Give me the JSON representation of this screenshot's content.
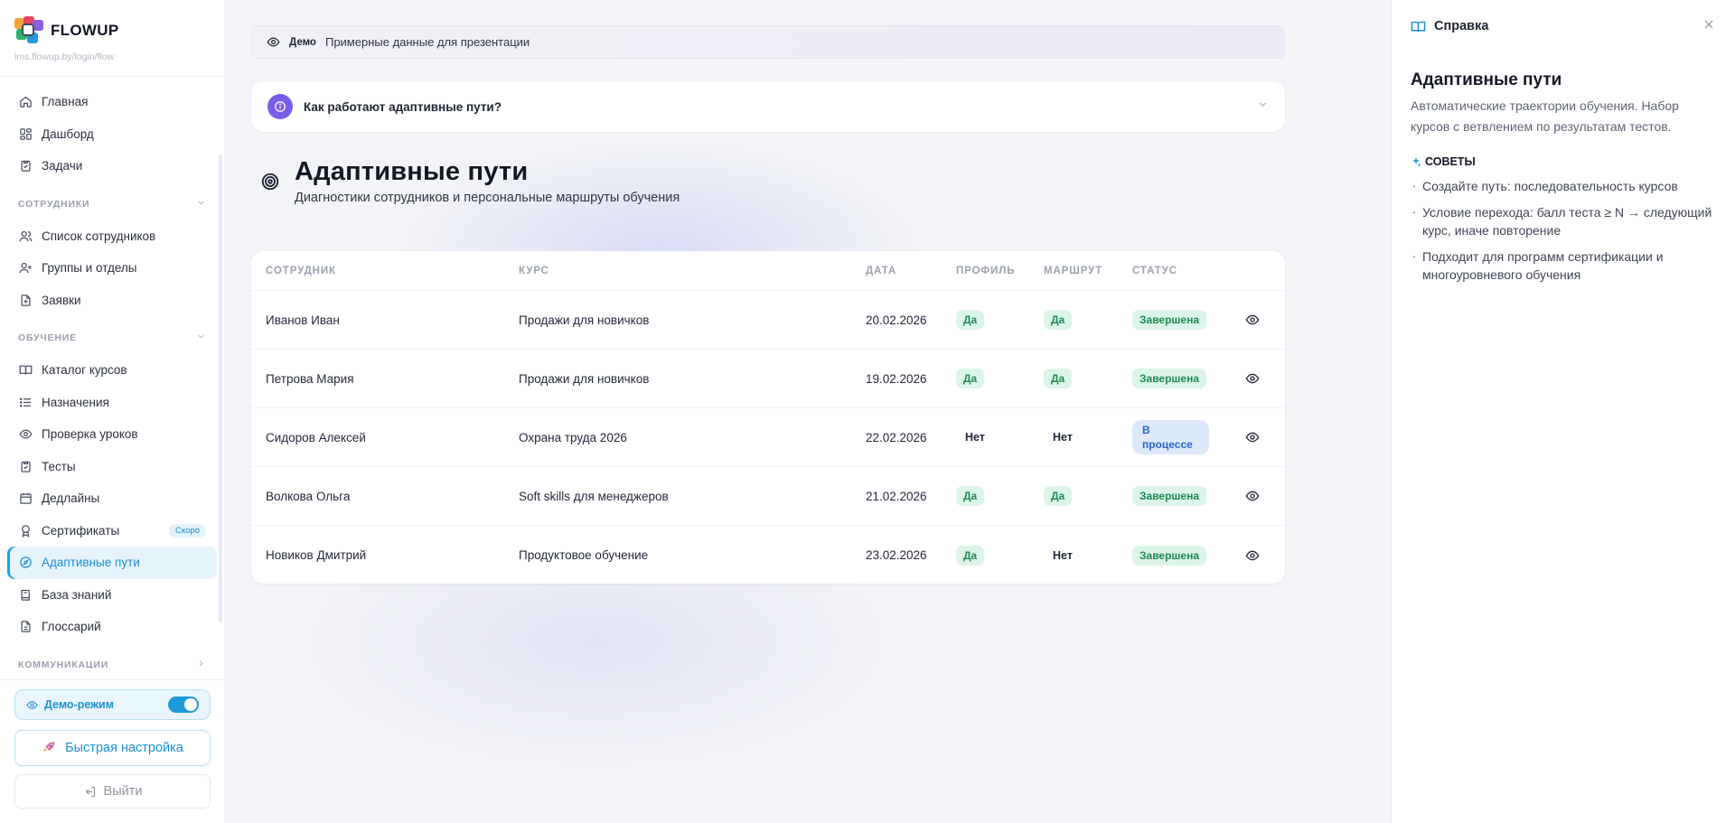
{
  "brand": {
    "name": "FLOWUP",
    "url": "lms.flowup.by/login/flow"
  },
  "nav": {
    "top": [
      {
        "label": "Главная",
        "icon": "home-icon"
      },
      {
        "label": "Дашборд",
        "icon": "dashboard-icon"
      },
      {
        "label": "Задачи",
        "icon": "clipboard-check-icon"
      }
    ],
    "sections": {
      "employees": "СОТРУДНИКИ",
      "learning": "ОБУЧЕНИЕ",
      "communications": "КОММУНИКАЦИИ"
    },
    "employees": [
      {
        "label": "Список сотрудников",
        "icon": "users-icon"
      },
      {
        "label": "Группы и отделы",
        "icon": "user-plus-icon"
      },
      {
        "label": "Заявки",
        "icon": "file-plus-icon"
      }
    ],
    "learning": [
      {
        "label": "Каталог курсов",
        "icon": "book-open-icon"
      },
      {
        "label": "Назначения",
        "icon": "list-icon"
      },
      {
        "label": "Проверка уроков",
        "icon": "eye-icon"
      },
      {
        "label": "Тесты",
        "icon": "clipboard-check-icon"
      },
      {
        "label": "Дедлайны",
        "icon": "calendar-icon"
      },
      {
        "label": "Сертификаты",
        "icon": "award-icon",
        "badge": "Скоро"
      },
      {
        "label": "Адаптивные пути",
        "icon": "compass-icon",
        "active": true
      },
      {
        "label": "База знаний",
        "icon": "book-icon"
      },
      {
        "label": "Глоссарий",
        "icon": "file-text-icon"
      }
    ]
  },
  "footer": {
    "demo_mode_label": "Демо-режим",
    "demo_mode_on": true,
    "quick_setup_label": "Быстрая настройка",
    "logout_label": "Выйти"
  },
  "demo_bar": {
    "tag": "Демо",
    "text": "Примерные данные для презентации"
  },
  "accordion": {
    "title": "Как работают адаптивные пути?"
  },
  "page": {
    "title": "Адаптивные пути",
    "subtitle": "Диагностики сотрудников и персональные маршруты обучения"
  },
  "table": {
    "columns": [
      "СОТРУДНИК",
      "КУРС",
      "ДАТА",
      "ПРОФИЛЬ",
      "МАРШРУТ",
      "СТАТУС"
    ],
    "rows": [
      {
        "employee": "Иванов Иван",
        "course": "Продажи для новичков",
        "date": "20.02.2026",
        "profile": "Да",
        "route": "Да",
        "status": "Завершена",
        "status_type": "done"
      },
      {
        "employee": "Петрова Мария",
        "course": "Продажи для новичков",
        "date": "19.02.2026",
        "profile": "Да",
        "route": "Да",
        "status": "Завершена",
        "status_type": "done"
      },
      {
        "employee": "Сидоров Алексей",
        "course": "Охрана труда 2026",
        "date": "22.02.2026",
        "profile": "Нет",
        "route": "Нет",
        "status": "В процессе",
        "status_type": "progress"
      },
      {
        "employee": "Волкова Ольга",
        "course": "Soft skills для менеджеров",
        "date": "21.02.2026",
        "profile": "Да",
        "route": "Да",
        "status": "Завершена",
        "status_type": "done"
      },
      {
        "employee": "Новиков Дмитрий",
        "course": "Продуктовое обучение",
        "date": "23.02.2026",
        "profile": "Да",
        "route": "Нет",
        "status": "Завершена",
        "status_type": "done"
      }
    ]
  },
  "help": {
    "header": "Справка",
    "title": "Адаптивные пути",
    "description": "Автоматические траектории обучения. Набор курсов с ветвлением по результатам тестов.",
    "tips_title": "СОВЕТЫ",
    "tips": [
      "Создайте путь: последовательность курсов",
      "Условие перехода: балл теста ≥ N → следующий курс, иначе повторение",
      "Подходит для программ сертификации и многоуровневого обучения"
    ]
  },
  "colors": {
    "accent": "#1a8fd1",
    "accent_bg": "#e7f3fb",
    "info_purple": "#7b5ce8",
    "status_done_bg": "#dcf5e8",
    "status_done_text": "#1d8a53",
    "status_progress_bg": "#dde9fb",
    "status_progress_text": "#2864d4"
  }
}
